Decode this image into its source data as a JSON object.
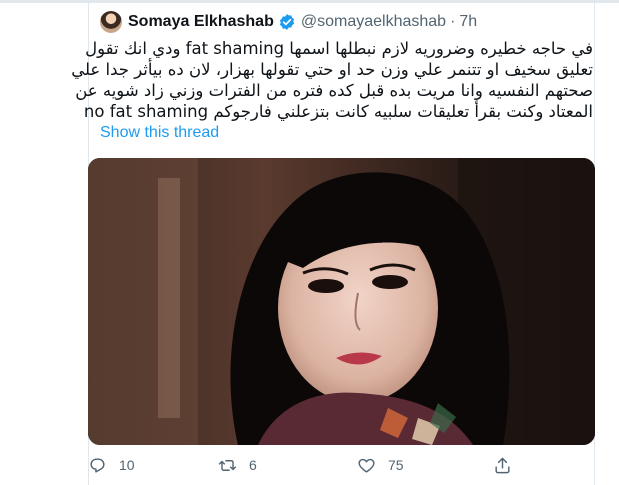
{
  "tweet": {
    "author": {
      "display_name": "Somaya Elkhashab",
      "handle": "@somayaelkhashab",
      "verified": true
    },
    "separator": "·",
    "time": "7h",
    "text_lines": [
      "في حاجه خطيره وضروريه لازم نبطلها اسمها fat shaming ودي انك تقول",
      "تعليق سخيف او تتنمر علي وزن حد او حتي تقولها بهزار، لان ده بيأثر جدا علي",
      "صحتهم النفسيه وانا مريت بده قبل كده فتره من الفترات وزني زاد شويه عن",
      "المعتاد وكنت بقرأ تعليقات سلبيه كانت بتزعلني فارجوكم no fat shaming"
    ],
    "show_thread": "Show this thread",
    "media": {
      "description_icon": "photo-of-woman"
    },
    "actions": {
      "reply": {
        "icon": "reply-icon",
        "count": "10"
      },
      "retweet": {
        "icon": "retweet-icon",
        "count": "6"
      },
      "like": {
        "icon": "heart-icon",
        "count": "75"
      },
      "share": {
        "icon": "share-icon"
      }
    }
  },
  "colors": {
    "link": "#1d9bf0",
    "verified": "#1d9bf0",
    "secondary_text": "#536471",
    "border": "#e1e8ed"
  }
}
